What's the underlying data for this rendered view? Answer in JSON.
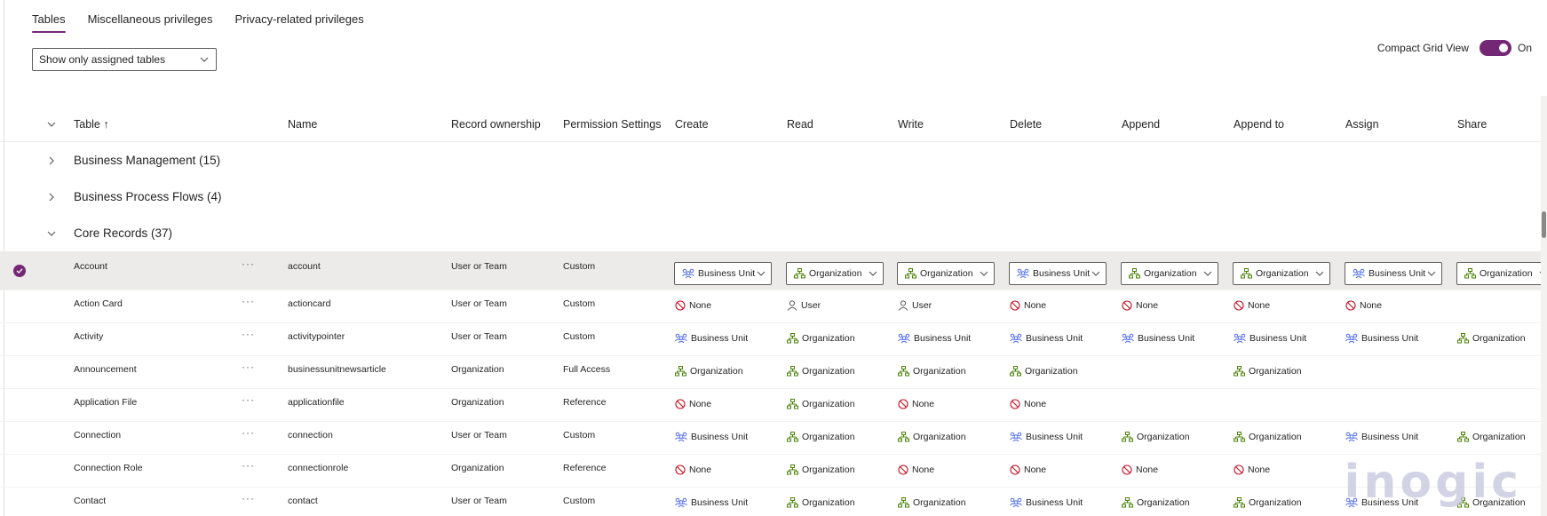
{
  "tabs": [
    "Tables",
    "Miscellaneous privileges",
    "Privacy-related privileges"
  ],
  "filter": {
    "value": "Show only assigned tables"
  },
  "compact": {
    "label": "Compact Grid View",
    "state": "On"
  },
  "columns": {
    "table": "Table ↑",
    "name": "Name",
    "ownership": "Record ownership",
    "settings": "Permission Settings",
    "create": "Create",
    "read": "Read",
    "write": "Write",
    "delete": "Delete",
    "append": "Append",
    "append_to": "Append to",
    "assign": "Assign",
    "share": "Share"
  },
  "groups": [
    {
      "label": "Business Management (15)"
    },
    {
      "label": "Business Process Flows (4)"
    },
    {
      "label": "Core Records (37)"
    }
  ],
  "rows": [
    {
      "table": "Account",
      "name": "account",
      "ownership": "User or Team",
      "settings": "Custom",
      "perms": [
        "Business Unit",
        "Organization",
        "Organization",
        "Business Unit",
        "Organization",
        "Organization",
        "Business Unit",
        "Organization"
      ]
    },
    {
      "table": "Action Card",
      "name": "actioncard",
      "ownership": "User or Team",
      "settings": "Custom",
      "perms": [
        "None",
        "User",
        "User",
        "None",
        "None",
        "None",
        "None",
        ""
      ]
    },
    {
      "table": "Activity",
      "name": "activitypointer",
      "ownership": "User or Team",
      "settings": "Custom",
      "perms": [
        "Business Unit",
        "Organization",
        "Business Unit",
        "Business Unit",
        "Business Unit",
        "Business Unit",
        "Business Unit",
        "Organization"
      ]
    },
    {
      "table": "Announcement",
      "name": "businessunitnewsarticle",
      "ownership": "Organization",
      "settings": "Full Access",
      "perms": [
        "Organization",
        "Organization",
        "Organization",
        "Organization",
        "",
        "Organization",
        "",
        ""
      ]
    },
    {
      "table": "Application File",
      "name": "applicationfile",
      "ownership": "Organization",
      "settings": "Reference",
      "perms": [
        "None",
        "Organization",
        "None",
        "None",
        "",
        "",
        "",
        ""
      ]
    },
    {
      "table": "Connection",
      "name": "connection",
      "ownership": "User or Team",
      "settings": "Custom",
      "perms": [
        "Business Unit",
        "Organization",
        "Organization",
        "Business Unit",
        "Organization",
        "Organization",
        "Business Unit",
        "Organization"
      ]
    },
    {
      "table": "Connection Role",
      "name": "connectionrole",
      "ownership": "Organization",
      "settings": "Reference",
      "perms": [
        "None",
        "Organization",
        "None",
        "None",
        "None",
        "None",
        "",
        ""
      ]
    },
    {
      "table": "Contact",
      "name": "contact",
      "ownership": "User or Team",
      "settings": "Custom",
      "perms": [
        "Business Unit",
        "Organization",
        "Organization",
        "Business Unit",
        "Organization",
        "Organization",
        "Business Unit",
        "Organization"
      ]
    }
  ],
  "colors": {
    "accent": "#742774",
    "org": "#498205",
    "bu": "#4f6bed",
    "none": "#c50f1f",
    "user": "#605e5c"
  },
  "watermark": "inogic"
}
